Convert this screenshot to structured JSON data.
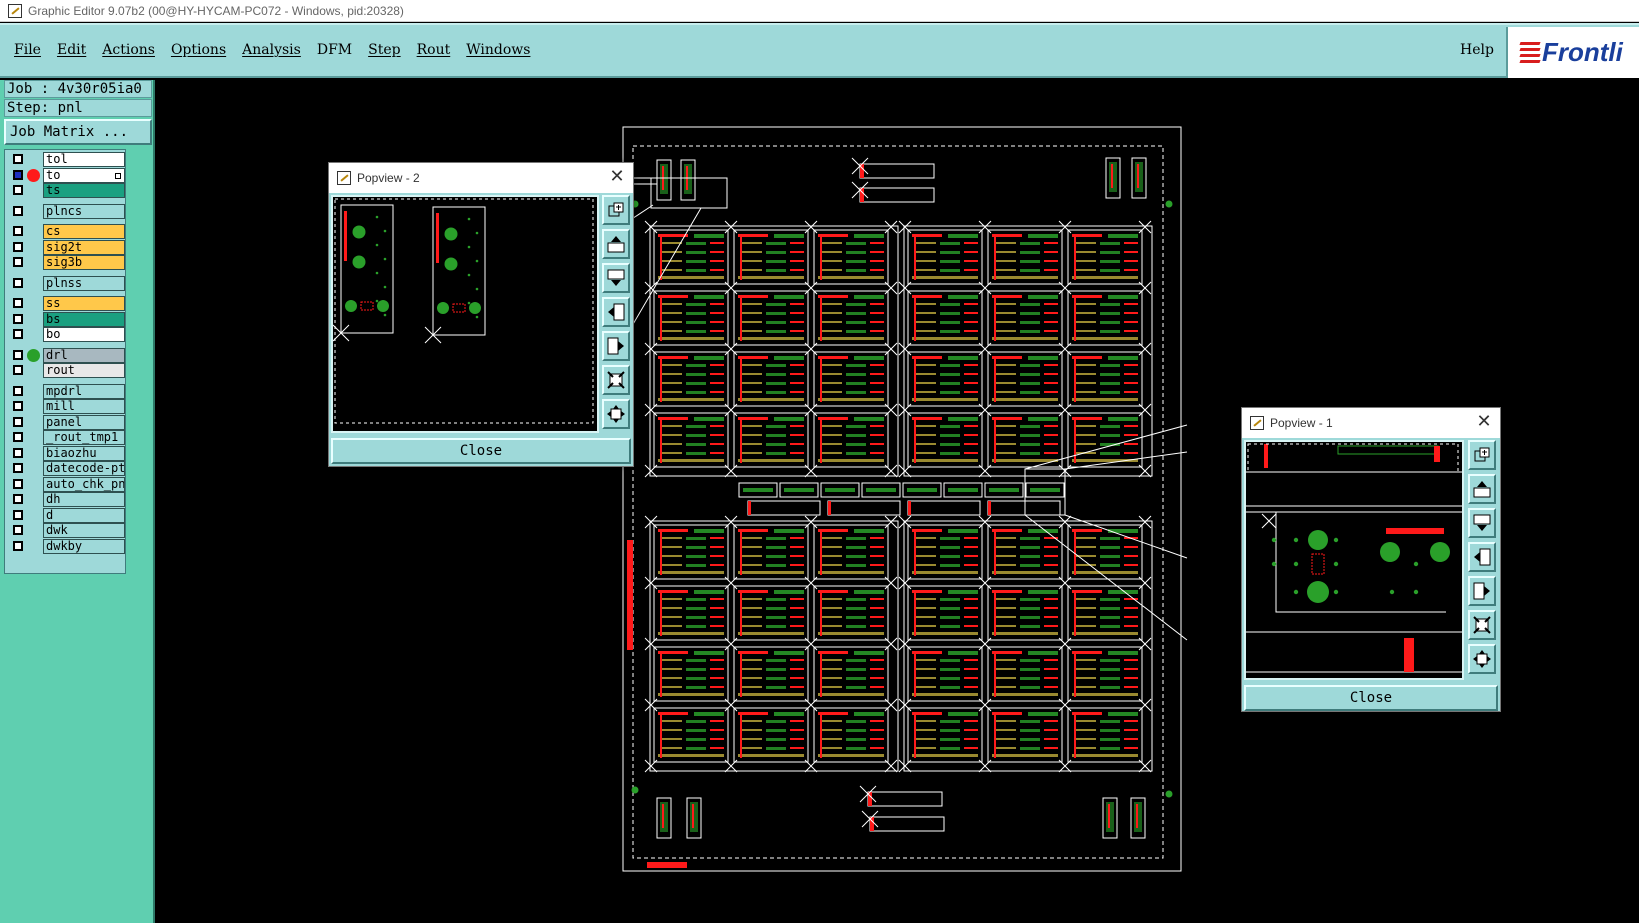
{
  "window": {
    "title": "Graphic Editor 9.07b2 (00@HY-HYCAM-PC072 - Windows, pid:20328)"
  },
  "menubar": {
    "items": [
      "File",
      "Edit",
      "Actions",
      "Options",
      "Analysis",
      "DFM",
      "Step",
      "Rout",
      "Windows"
    ],
    "help": "Help",
    "logo_text": "Frontli"
  },
  "job": {
    "label": "Job : 4v30r05ia0",
    "step": "Step: pnl",
    "matrix_button": "Job Matrix ..."
  },
  "layers": [
    {
      "name": "tol",
      "color": "#ffffff"
    },
    {
      "name": "to",
      "color": "#ffffff",
      "dot": "#ff1a1a",
      "checked": true,
      "mark": true
    },
    {
      "name": "ts",
      "color": "#1aa080"
    },
    {
      "name": "plncs",
      "color": "#9ed9d9"
    },
    {
      "name": "cs",
      "color": "#ffc84a"
    },
    {
      "name": "sig2t",
      "color": "#ffc84a"
    },
    {
      "name": "sig3b",
      "color": "#ffc84a"
    },
    {
      "name": "plnss",
      "color": "#9ed9d9"
    },
    {
      "name": "ss",
      "color": "#ffc84a"
    },
    {
      "name": "bs",
      "color": "#1aa080"
    },
    {
      "name": "bo",
      "color": "#ffffff"
    },
    {
      "name": "drl",
      "color": "#a8b8c0",
      "dot": "#2aa02a"
    },
    {
      "name": "rout",
      "color": "#e8e8e8"
    },
    {
      "name": "mpdrl",
      "color": "#9ed9d9"
    },
    {
      "name": "mill",
      "color": "#9ed9d9"
    },
    {
      "name": "panel",
      "color": "#9ed9d9"
    },
    {
      "name": "_rout_tmp1",
      "color": "#9ed9d9"
    },
    {
      "name": "biaozhu",
      "color": "#9ed9d9"
    },
    {
      "name": "datecode-pte",
      "color": "#9ed9d9"
    },
    {
      "name": "auto_chk_pnl",
      "color": "#9ed9d9"
    },
    {
      "name": "dh",
      "color": "#9ed9d9"
    },
    {
      "name": "d",
      "color": "#9ed9d9"
    },
    {
      "name": "dwk",
      "color": "#9ed9d9"
    },
    {
      "name": "dwkby",
      "color": "#9ed9d9"
    }
  ],
  "popview2": {
    "title": "Popview - 2",
    "close_label": "Close"
  },
  "popview1": {
    "title": "Popview - 1",
    "close_label": "Close"
  },
  "colors": {
    "pcb_red": "#ff1a1a",
    "pcb_green": "#2aa02a",
    "pcb_outline": "#ffffff",
    "pad_olive": "#9a8a30"
  },
  "icons": [
    "pan-icon",
    "zoom-up-icon",
    "zoom-down-icon",
    "pan-left-icon",
    "pan-right-icon",
    "zoom-fit-icon",
    "zoom-home-icon"
  ]
}
